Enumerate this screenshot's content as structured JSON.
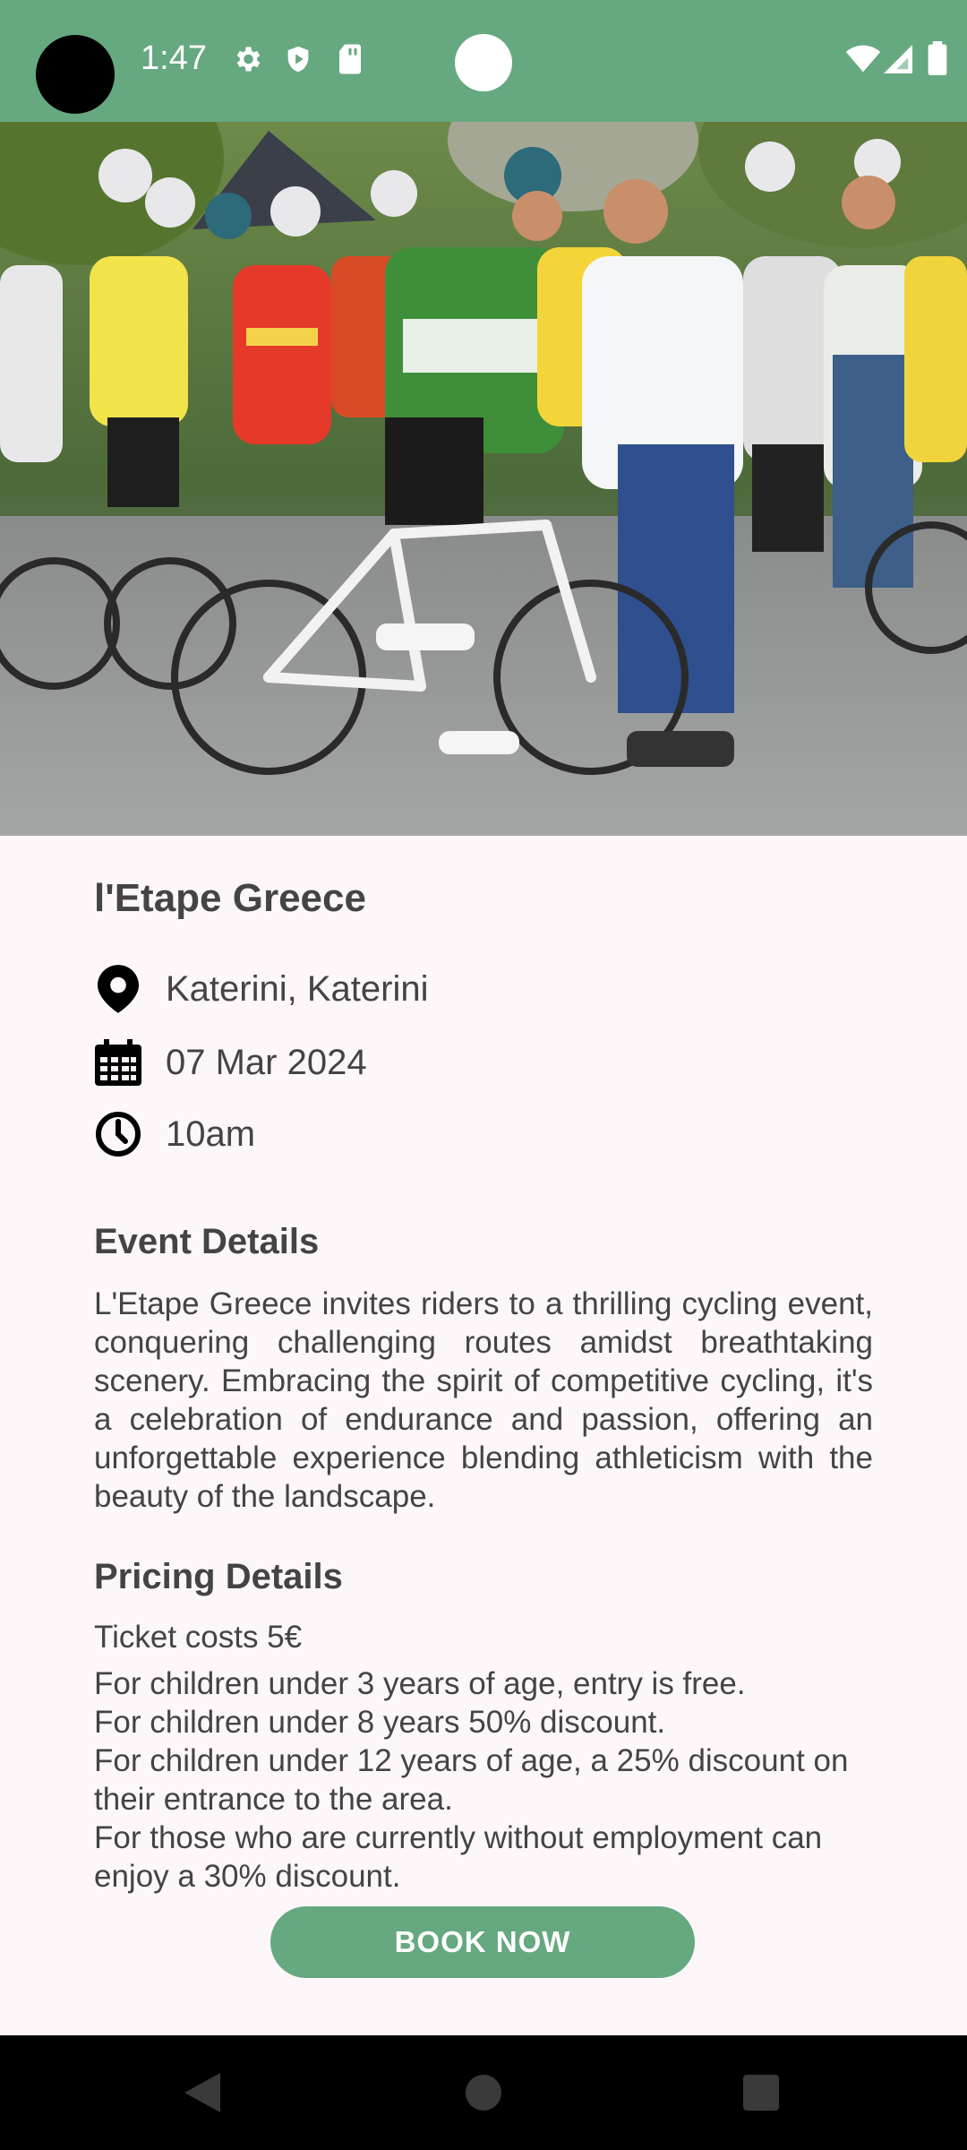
{
  "status_bar": {
    "time": "1:47",
    "left_icons": [
      "gear-icon",
      "shield-play-icon",
      "sd-card-icon"
    ],
    "right_icons": [
      "wifi-icon",
      "signal-icon",
      "battery-icon"
    ],
    "background_color": "#66a880"
  },
  "hero_image": {
    "description_icon": "event-photo"
  },
  "event": {
    "title": "l'Etape Greece",
    "location": "Katerini, Katerini",
    "date": "07 Mar 2024",
    "time": "10am"
  },
  "event_details": {
    "heading": "Event Details",
    "body": "L'Etape Greece invites riders to a thrilling cycling event, conquering challenging routes amidst breathtaking scenery. Embracing the spirit of competitive cycling, it's a celebration of endurance and passion, offering an unforgettable experience blending athleticism with the beauty of the landscape."
  },
  "pricing_details": {
    "heading": "Pricing Details",
    "ticket": "Ticket costs 5€",
    "lines": [
      "For children under 3 years of age, entry is free.",
      "For children under 8 years 50% discount.",
      "For children under 12 years of age, a 25% discount on their entrance to the area.",
      "For those who are currently without employment can enjoy a 30% discount."
    ]
  },
  "actions": {
    "book_label": "BOOK NOW"
  },
  "nav": {
    "icons": [
      "back-icon",
      "home-icon",
      "recents-icon"
    ]
  },
  "colors": {
    "accent": "#66a880",
    "background": "#fdf7fa",
    "text": "#444444"
  }
}
